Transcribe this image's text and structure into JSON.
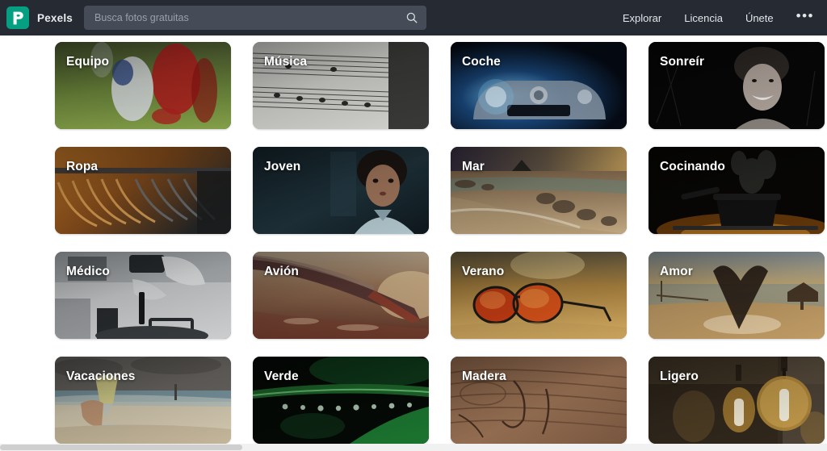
{
  "header": {
    "logo_icon": "pexels-logo-icon",
    "brand_name": "Pexels",
    "search": {
      "placeholder": "Busca fotos gratuitas",
      "value": "",
      "icon": "search-icon"
    },
    "nav": [
      {
        "label": "Explorar"
      },
      {
        "label": "Licencia"
      },
      {
        "label": "Únete"
      }
    ],
    "more_label": "•••",
    "background_color": "#252a33",
    "logo_color": "#05a081",
    "search_field_color": "#454b57"
  },
  "grid": {
    "columns": 4,
    "tiles": [
      {
        "label": "Equipo",
        "theme": "soccer"
      },
      {
        "label": "Música",
        "theme": "sheetmusic"
      },
      {
        "label": "Coche",
        "theme": "car"
      },
      {
        "label": "Sonreír",
        "theme": "smile"
      },
      {
        "label": "Ropa",
        "theme": "hangers"
      },
      {
        "label": "Joven",
        "theme": "child"
      },
      {
        "label": "Mar",
        "theme": "sea"
      },
      {
        "label": "Cocinando",
        "theme": "cooking"
      },
      {
        "label": "Médico",
        "theme": "medical"
      },
      {
        "label": "Avión",
        "theme": "plane"
      },
      {
        "label": "Verano",
        "theme": "summer"
      },
      {
        "label": "Amor",
        "theme": "love"
      },
      {
        "label": "Vacaciones",
        "theme": "vacation"
      },
      {
        "label": "Verde",
        "theme": "green"
      },
      {
        "label": "Madera",
        "theme": "wood"
      },
      {
        "label": "Ligero",
        "theme": "light"
      }
    ]
  },
  "scrollbar": {
    "orientation": "horizontal",
    "track_color": "#f1f1f1",
    "thumb_color": "#cfcfcf"
  }
}
